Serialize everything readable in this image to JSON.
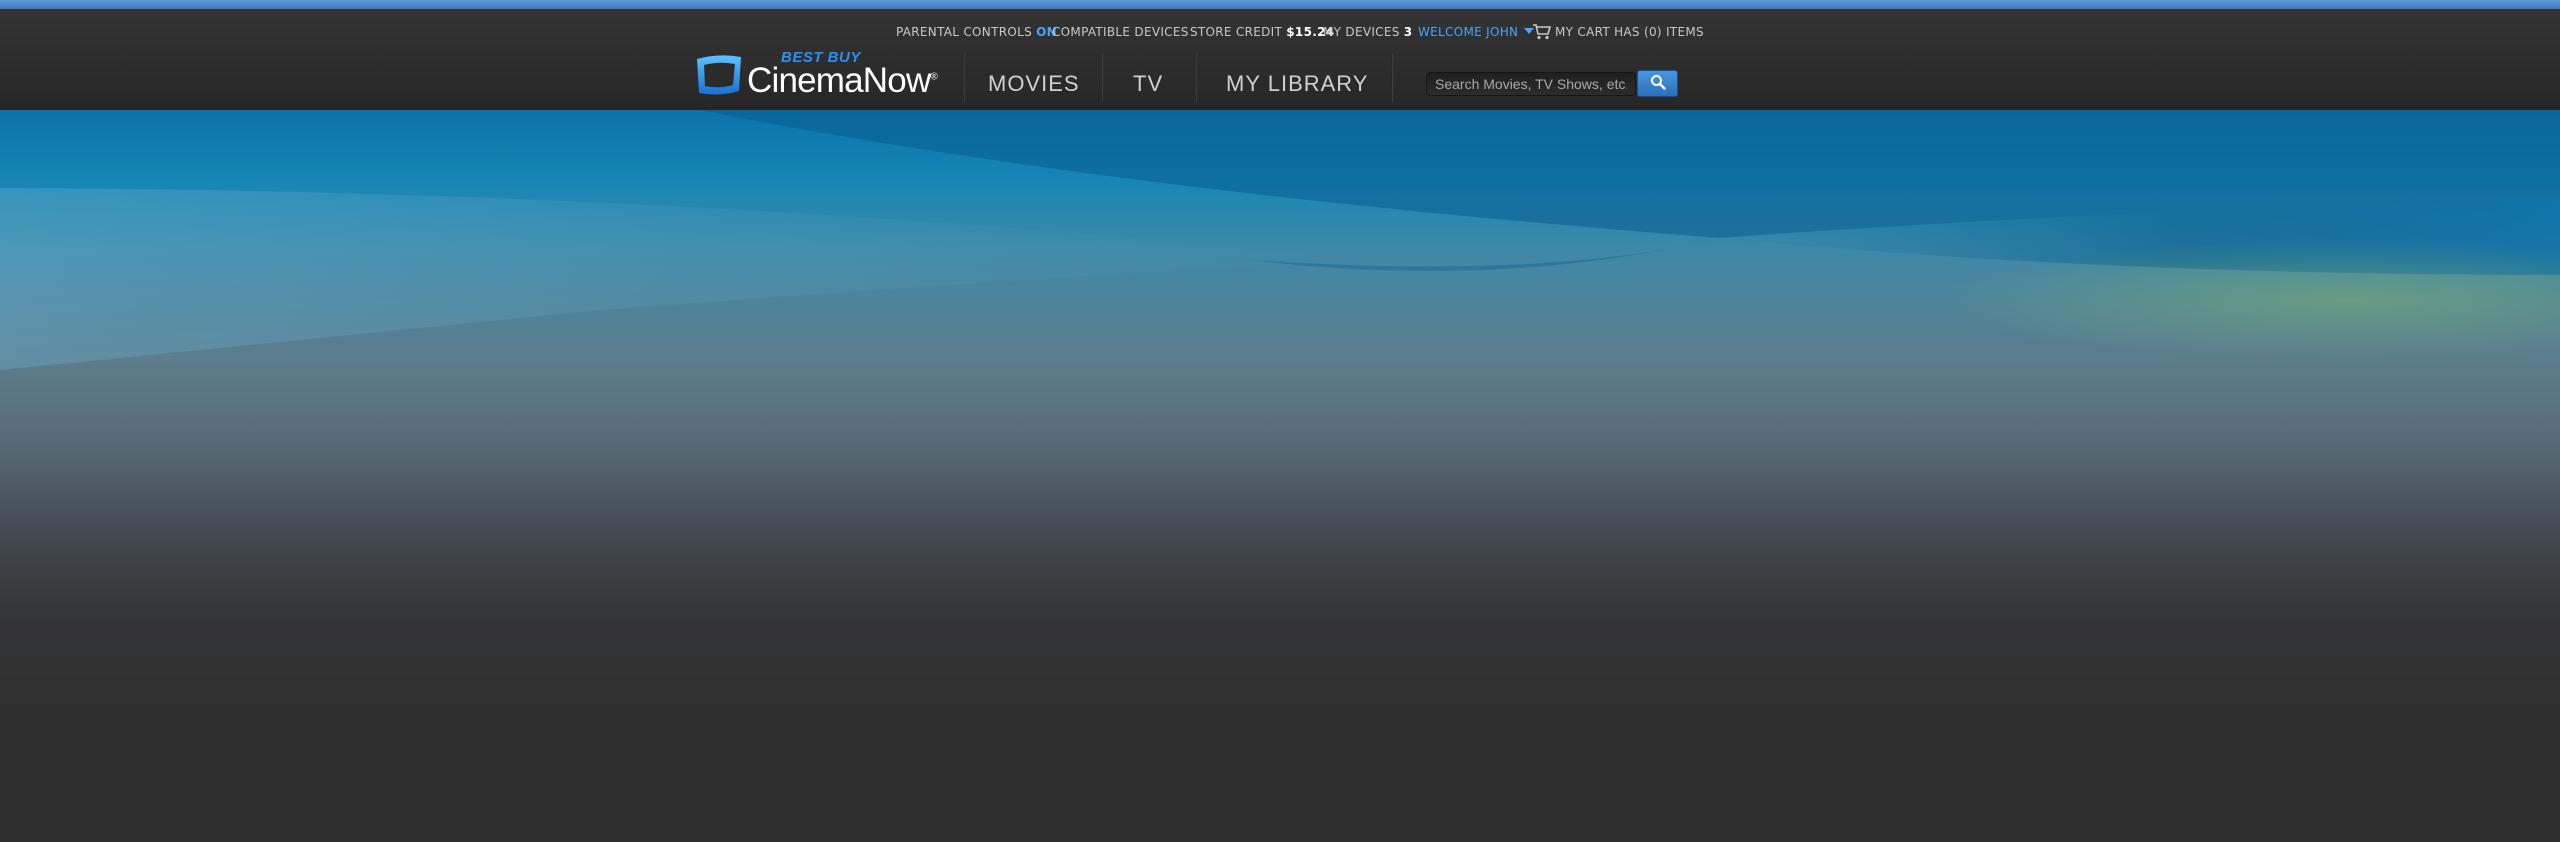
{
  "utility": {
    "parental_label": "PARENTAL CONTROLS",
    "parental_value": "ON",
    "compatible": "COMPATIBLE DEVICES",
    "store_credit_label": "STORE CREDIT",
    "store_credit_value": "$15.24",
    "devices_label": "MY DEVICES",
    "devices_value": "3",
    "welcome": "WELCOME JOHN",
    "cart": "MY CART HAS (0) ITEMS"
  },
  "logo": {
    "brand_small": "BEST BUY",
    "brand_name": "CinemaNow",
    "trademark": "®"
  },
  "nav": {
    "movies": "MOVIES",
    "tv": "TV",
    "library": "MY LIBRARY"
  },
  "search": {
    "placeholder": "Search Movies, TV Shows, etc."
  },
  "icons": {
    "logo": "tv-screen-icon",
    "cart": "cart-icon",
    "search": "magnifier-icon",
    "welcome": "chevron-down-icon"
  },
  "colors": {
    "accent": "#4aa3ff",
    "top_strip": "#4a8ad0",
    "header_bg": "#2e2e2e",
    "search_button": "#3a84d0"
  }
}
